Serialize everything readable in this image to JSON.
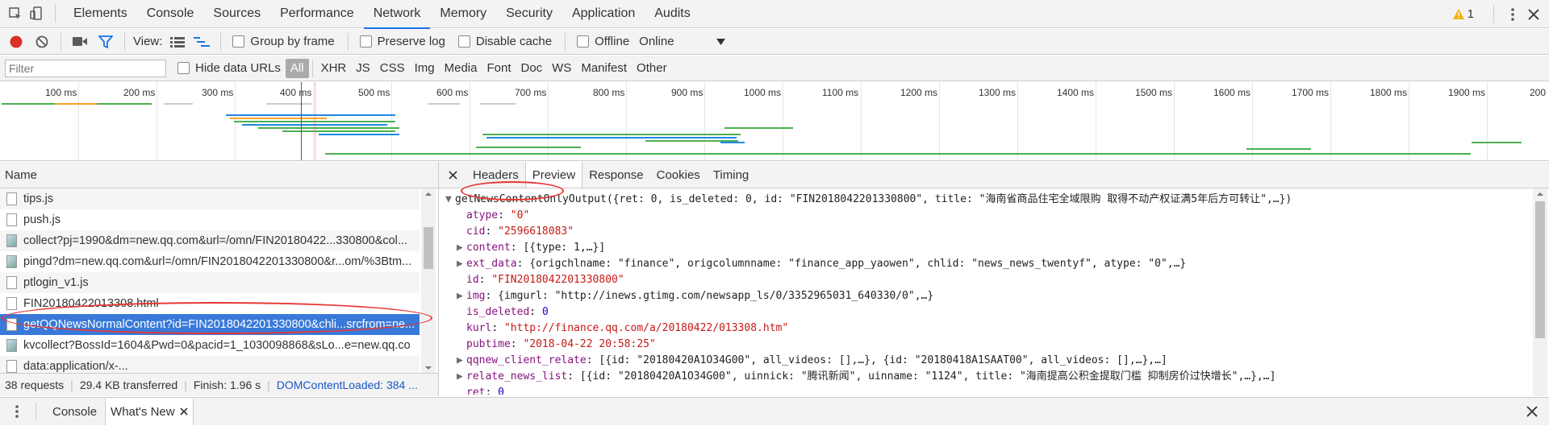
{
  "main_tabs": [
    "Elements",
    "Console",
    "Sources",
    "Performance",
    "Network",
    "Memory",
    "Security",
    "Application",
    "Audits"
  ],
  "active_tab": "Network",
  "warning_count": "1",
  "toolbar": {
    "view_label": "View:",
    "group_by_frame": "Group by frame",
    "preserve_log": "Preserve log",
    "disable_cache": "Disable cache",
    "offline": "Offline",
    "throttle": "Online"
  },
  "filter": {
    "placeholder": "Filter",
    "hide_data_urls": "Hide data URLs",
    "types": [
      "All",
      "XHR",
      "JS",
      "CSS",
      "Img",
      "Media",
      "Font",
      "Doc",
      "WS",
      "Manifest",
      "Other"
    ]
  },
  "timeline_ticks": [
    "100 ms",
    "200 ms",
    "300 ms",
    "400 ms",
    "500 ms",
    "600 ms",
    "700 ms",
    "800 ms",
    "900 ms",
    "1000 ms",
    "1100 ms",
    "1200 ms",
    "1300 ms",
    "1400 ms",
    "1500 ms",
    "1600 ms",
    "1700 ms",
    "1800 ms",
    "1900 ms",
    "200"
  ],
  "name_header": "Name",
  "requests": [
    {
      "name": "tips.js",
      "type": "doc"
    },
    {
      "name": "push.js",
      "type": "doc"
    },
    {
      "name": "collect?pj=1990&dm=new.qq.com&url=/omn/FIN20180422...330800&col...",
      "type": "img"
    },
    {
      "name": "pingd?dm=new.qq.com&url=/omn/FIN2018042201330800&r...om/%3Btm...",
      "type": "img"
    },
    {
      "name": "ptlogin_v1.js",
      "type": "doc"
    },
    {
      "name": "FIN20180422013308.html",
      "type": "doc"
    },
    {
      "name": "getQQNewsNormalContent?id=FIN2018042201330800&chli...srcfrom=ne...",
      "type": "doc",
      "selected": true
    },
    {
      "name": "kvcollect?BossId=1604&Pwd=0&pacid=1_1030098868&sLo...e=new.qq.co",
      "type": "img"
    },
    {
      "name": "data:application/x-...",
      "type": "doc"
    }
  ],
  "status": {
    "requests": "38 requests",
    "transferred": "29.4 KB transferred",
    "finish": "Finish: 1.96 s",
    "dcl": "DOMContentLoaded: 384 ..."
  },
  "detail_tabs": [
    "Headers",
    "Preview",
    "Response",
    "Cookies",
    "Timing"
  ],
  "active_detail_tab": "Preview",
  "preview": {
    "root_fn": "getNewsContentOnlyOutput",
    "root_summary": "({ret: 0, is_deleted: 0, id: \"FIN2018042201330800\", title: \"海南省商品住宅全域限购 取得不动产权证满5年后方可转让\",…})",
    "atype_key": "atype",
    "atype_val": "\"0\"",
    "cid_key": "cid",
    "cid_val": "\"2596618083\"",
    "content_key": "content",
    "content_val": "[{type: 1,…}]",
    "ext_key": "ext_data",
    "ext_val": "{origchlname: \"finance\", origcolumnname: \"finance_app_yaowen\", chlid: \"news_news_twentyf\", atype: \"0\",…}",
    "id_key": "id",
    "id_val": "\"FIN2018042201330800\"",
    "img_key": "img",
    "img_val": "{imgurl: \"http://inews.gtimg.com/newsapp_ls/0/3352965031_640330/0\",…}",
    "isdel_key": "is_deleted",
    "isdel_val": "0",
    "kurl_key": "kurl",
    "kurl_val": "\"http://finance.qq.com/a/20180422/013308.htm\"",
    "pubtime_key": "pubtime",
    "pubtime_val": "\"2018-04-22 20:58:25\"",
    "qqnew_key": "qqnew_client_relate",
    "qqnew_val": "[{id: \"20180420A1O34G00\", all_videos: [],…}, {id: \"20180418A1SAAT00\", all_videos: [],…},…]",
    "relate_key": "relate_news_list",
    "relate_val": "[{id: \"20180420A1O34G00\", uinnick: \"腾讯新闻\", uinname: \"1124\", title: \"海南提高公积金提取门槛 抑制房价过快增长\",…},…]",
    "ret_key": "ret",
    "ret_val": "0"
  },
  "drawer_tabs": [
    "Console",
    "What's New"
  ],
  "active_drawer_tab": "What's New",
  "colors": {
    "accent": "#1a73e8",
    "selected_row": "#3879d9",
    "annotation": "#e53935"
  }
}
